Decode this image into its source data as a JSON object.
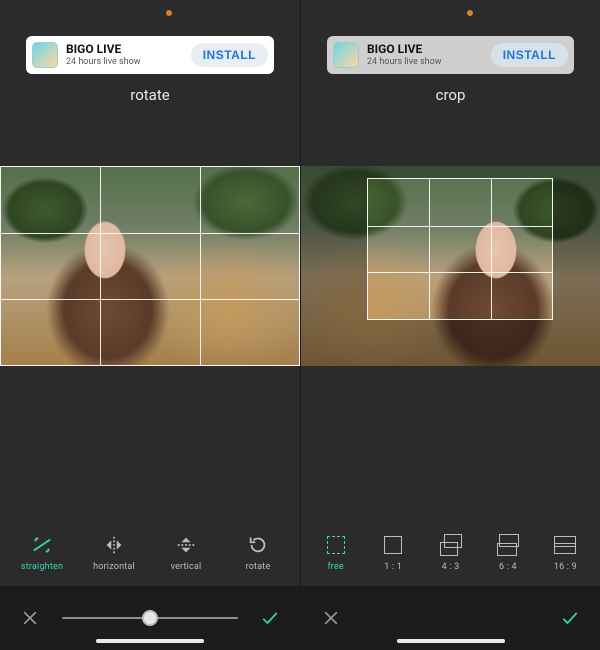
{
  "ad": {
    "title": "BIGO LIVE",
    "subtitle": "24 hours live show",
    "cta": "INSTALL"
  },
  "left": {
    "mode_label": "rotate",
    "tools": [
      {
        "id": "straighten",
        "label": "straighten",
        "active": true
      },
      {
        "id": "horizontal",
        "label": "horizontal",
        "active": false
      },
      {
        "id": "vertical",
        "label": "vertical",
        "active": false
      },
      {
        "id": "rotate",
        "label": "rotate",
        "active": false
      }
    ],
    "cancel_icon": "close-icon",
    "accept_icon": "check-icon",
    "slider_value": 0.5
  },
  "right": {
    "mode_label": "crop",
    "ratios": [
      {
        "id": "free",
        "label": "free",
        "active": true
      },
      {
        "id": "1_1",
        "label": "1 : 1",
        "active": false
      },
      {
        "id": "4_3",
        "label": "4 : 3",
        "active": false
      },
      {
        "id": "6_4",
        "label": "6 : 4",
        "active": false
      },
      {
        "id": "16_9",
        "label": "16 : 9",
        "active": false
      }
    ],
    "cancel_icon": "close-icon",
    "accept_icon": "check-icon"
  },
  "colors": {
    "accent": "#35d8b4",
    "bg": "#2b2b2b",
    "bottombar_bg": "#1c1c1c"
  }
}
